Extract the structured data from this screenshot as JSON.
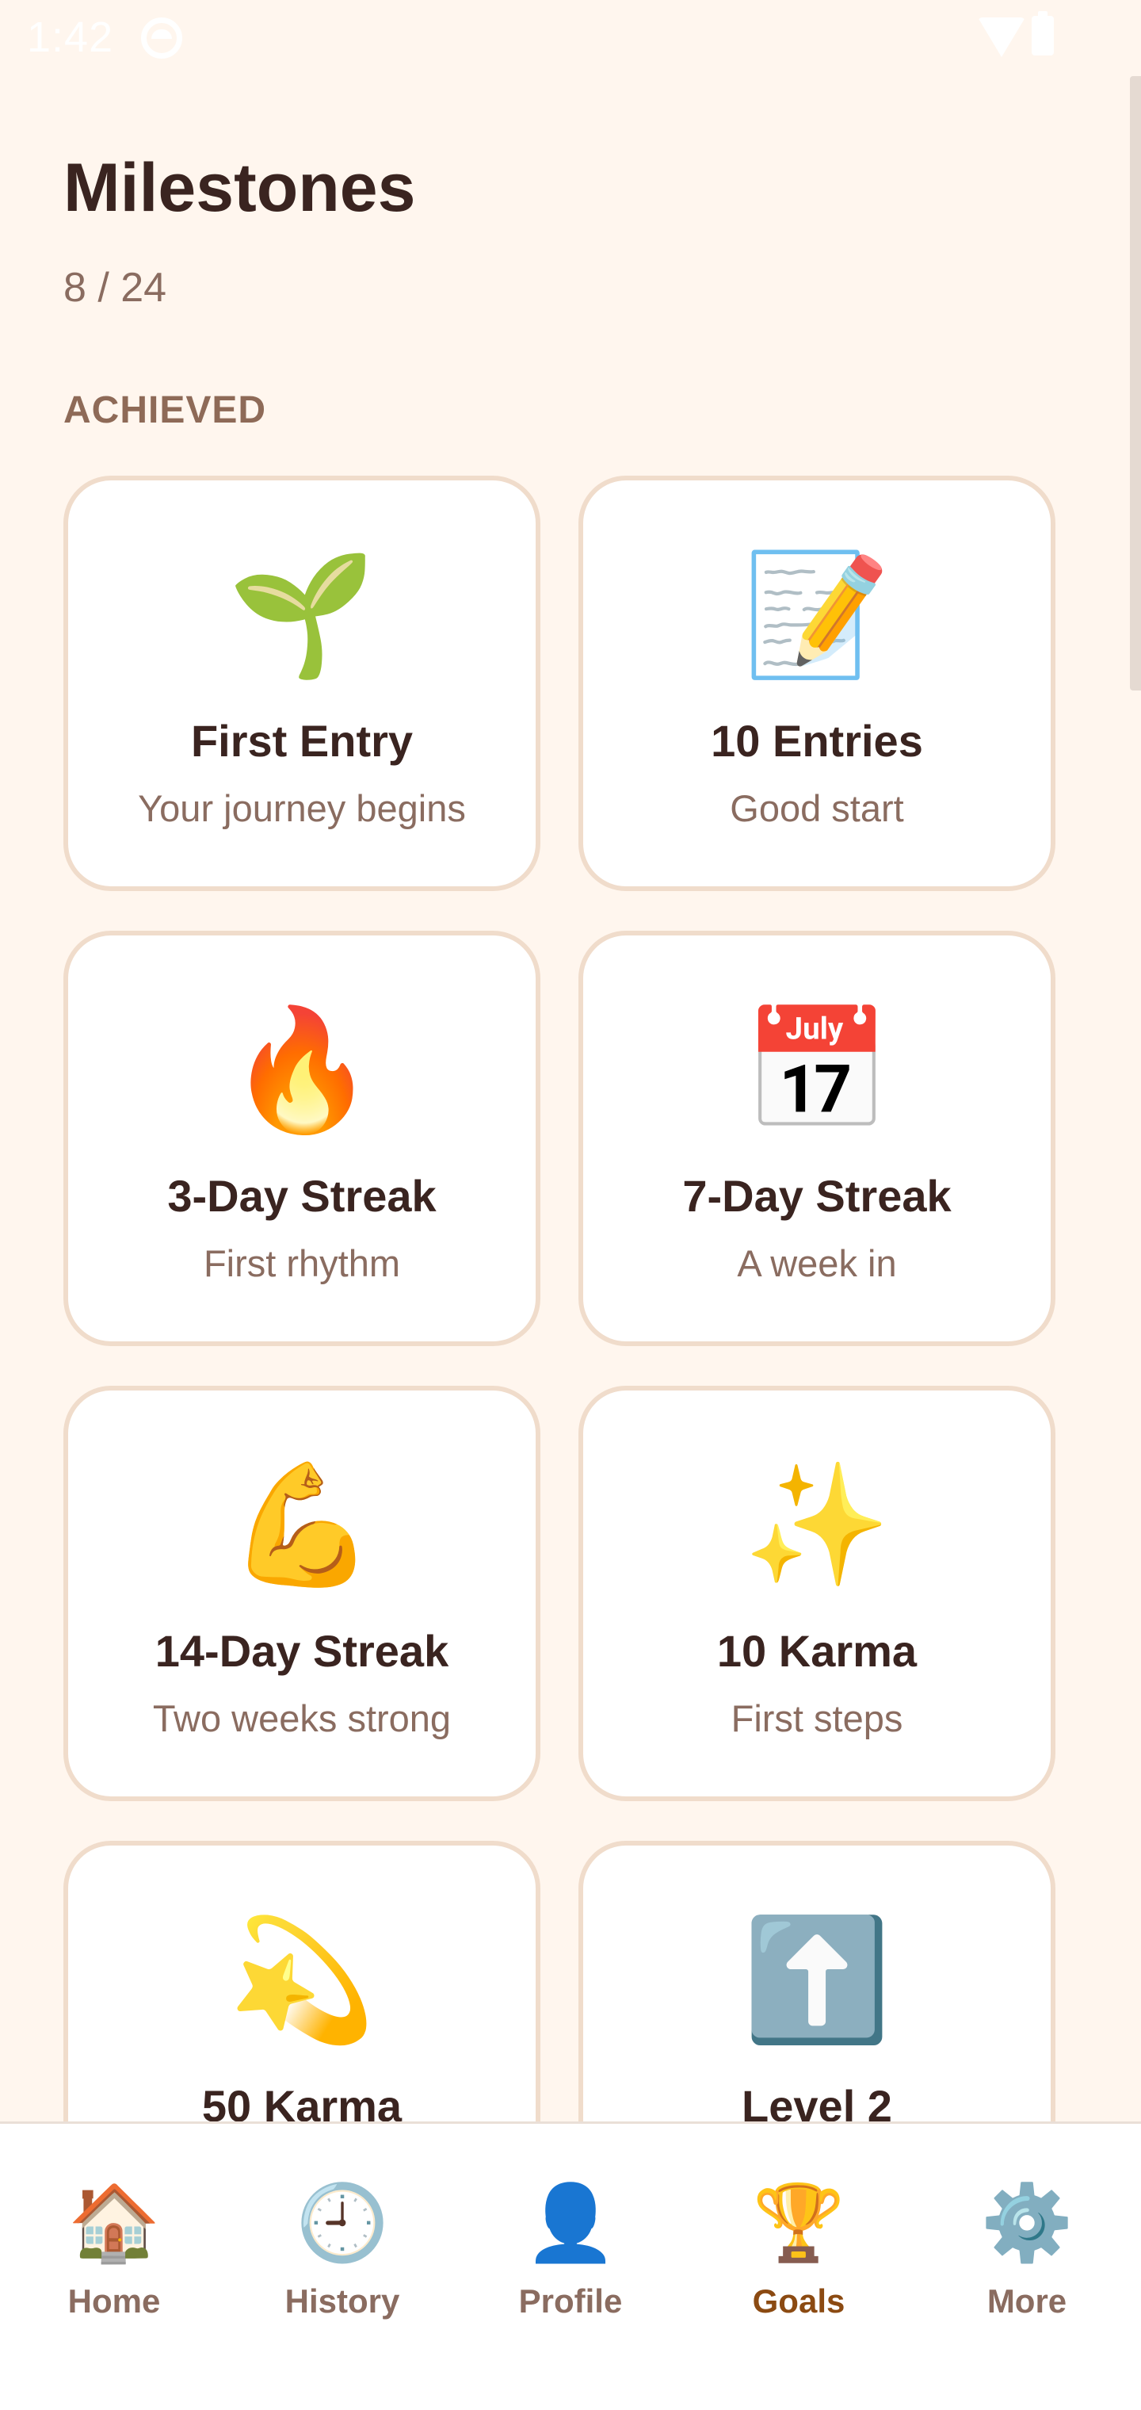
{
  "status_bar": {
    "time": "1:42"
  },
  "header": {
    "title": "Milestones",
    "progress": "8 / 24",
    "section_label": "ACHIEVED"
  },
  "milestones": [
    {
      "icon": "🌱",
      "icon_name": "seedling-icon",
      "title": "First Entry",
      "subtitle": "Your journey begins"
    },
    {
      "icon": "📝",
      "icon_name": "memo-icon",
      "title": "10 Entries",
      "subtitle": "Good start"
    },
    {
      "icon": "🔥",
      "icon_name": "fire-icon",
      "title": "3-Day Streak",
      "subtitle": "First rhythm"
    },
    {
      "icon": "📅",
      "icon_name": "calendar-icon",
      "title": "7-Day Streak",
      "subtitle": "A week in"
    },
    {
      "icon": "💪",
      "icon_name": "flexed-bicep-icon",
      "title": "14-Day Streak",
      "subtitle": "Two weeks strong"
    },
    {
      "icon": "✨",
      "icon_name": "sparkles-icon",
      "title": "10 Karma",
      "subtitle": "First steps"
    },
    {
      "icon": "💫",
      "icon_name": "dizzy-star-icon",
      "title": "50 Karma",
      "subtitle": ""
    },
    {
      "icon": "⬆️",
      "icon_name": "up-arrow-icon",
      "title": "Level 2",
      "subtitle": ""
    }
  ],
  "bottom_nav": {
    "items": [
      {
        "label": "Home",
        "icon": "🏠",
        "icon_name": "house-icon"
      },
      {
        "label": "History",
        "icon": "🕘",
        "icon_name": "clock-icon"
      },
      {
        "label": "Profile",
        "icon": "👤",
        "icon_name": "profile-silhouette-icon"
      },
      {
        "label": "Goals",
        "icon": "🏆",
        "icon_name": "trophy-icon"
      },
      {
        "label": "More",
        "icon": "⚙️",
        "icon_name": "gear-icon"
      }
    ],
    "active": "Goals"
  },
  "colors": {
    "background": "#FFF6EE",
    "card_border": "#F0DCCB",
    "title_text": "#3A2420",
    "muted_text": "#8A6C60",
    "section_text": "#8E6A57",
    "active_nav": "#8B4A12"
  }
}
